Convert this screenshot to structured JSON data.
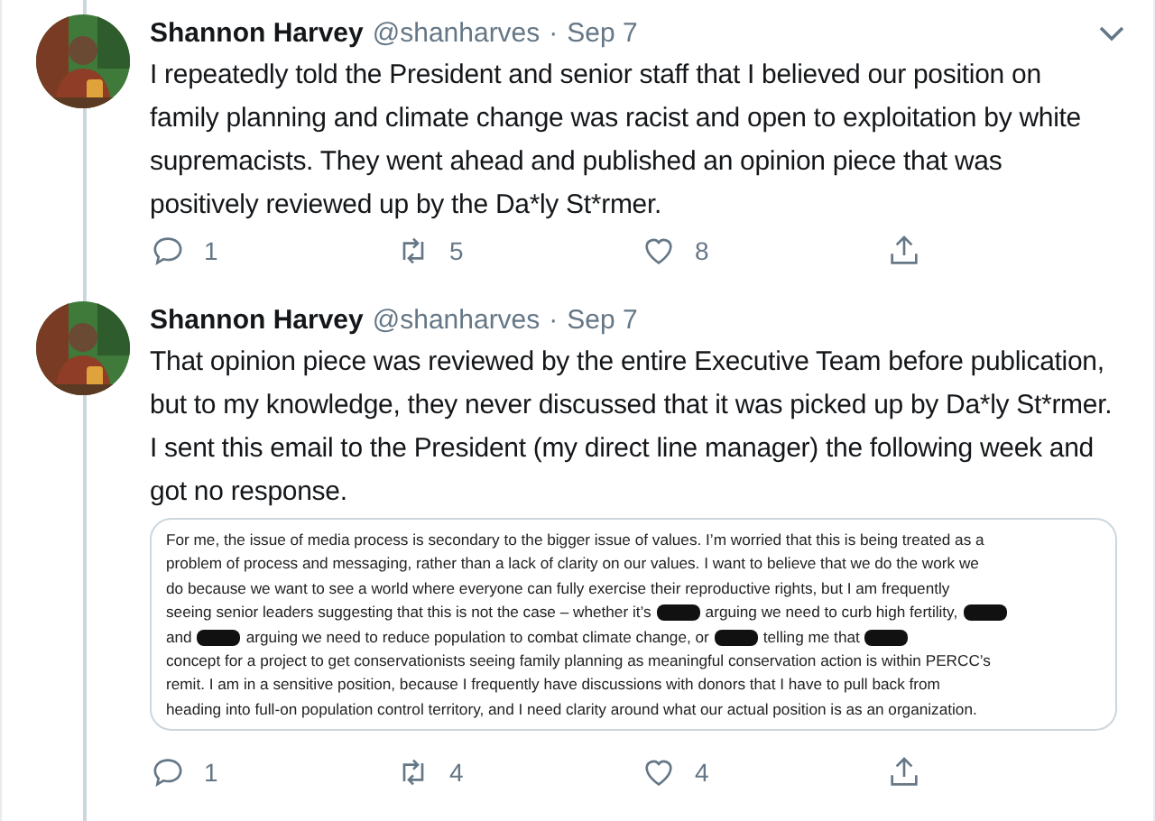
{
  "tweets": [
    {
      "name": "Shannon Harvey",
      "handle": "@shanharves",
      "separator": "·",
      "date": "Sep 7",
      "menu": true,
      "text": "I repeatedly told the President and senior staff that I believed our position on family planning and climate change was racist and open to exploitation by white supremacists. They went ahead and published an opinion piece that was positively reviewed up by the Da*ly St*rmer.",
      "replies": "1",
      "retweets": "5",
      "likes": "8"
    },
    {
      "name": "Shannon Harvey",
      "handle": "@shanharves",
      "separator": "·",
      "date": "Sep 7",
      "menu": false,
      "text": "That opinion piece was reviewed by the entire Executive Team before publication, but to my knowledge, they never discussed that it was picked up by Da*ly St*rmer. I sent this email to the President (my direct line manager) the following week and got no response.",
      "email_lines": [
        [
          {
            "kind": "text",
            "text": "For me, the issue of media process is secondary to the bigger issue of values. I’m worried that this is being treated as a"
          }
        ],
        [
          {
            "kind": "text",
            "text": "problem of process and messaging, rather than a lack of clarity on our values. I want to believe that we do the work we"
          }
        ],
        [
          {
            "kind": "text",
            "text": "do because we want to see a world where everyone can fully exercise their reproductive rights, but I am frequently"
          }
        ],
        [
          {
            "kind": "text",
            "text": "seeing senior leaders suggesting that this is not the case – whether it’s"
          },
          {
            "kind": "redaction"
          },
          {
            "kind": "text",
            "text": "arguing we need to curb high fertility,"
          },
          {
            "kind": "redaction"
          }
        ],
        [
          {
            "kind": "text",
            "text": "and"
          },
          {
            "kind": "redaction"
          },
          {
            "kind": "text",
            "text": "arguing we need to reduce population to combat climate change, or"
          },
          {
            "kind": "redaction"
          },
          {
            "kind": "text",
            "text": "telling me that"
          },
          {
            "kind": "redaction"
          }
        ],
        [
          {
            "kind": "text",
            "text": "concept for a project to get conservationists seeing family planning as meaningful conservation action is within PERCC’s"
          }
        ],
        [
          {
            "kind": "text",
            "text": "remit. I am in a sensitive position, because I frequently have discussions with donors that I have to pull back from"
          }
        ],
        [
          {
            "kind": "text",
            "text": "heading into full-on population control territory, and I need clarity around what our actual position is as an organization."
          }
        ]
      ],
      "replies": "1",
      "retweets": "4",
      "likes": "4"
    }
  ]
}
